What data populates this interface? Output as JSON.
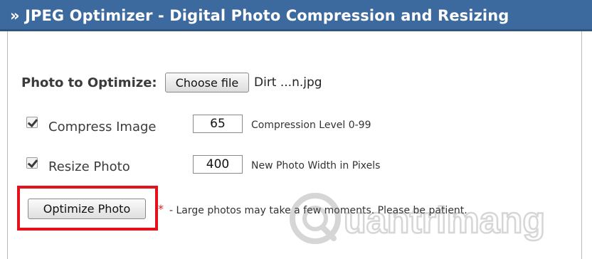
{
  "header": {
    "title": "» JPEG Optimizer - Digital Photo Compression and Resizing"
  },
  "file": {
    "label": "Photo to Optimize:",
    "button_label": "Choose file",
    "file_name": "Dirt ...n.jpg"
  },
  "options": [
    {
      "label": "Compress Image",
      "checked": true,
      "value": "65",
      "hint": "Compression Level 0-99"
    },
    {
      "label": "Resize Photo",
      "checked": true,
      "value": "400",
      "hint": "New Photo Width in Pixels"
    }
  ],
  "submit": {
    "label": "Optimize Photo",
    "asterisk": "*",
    "note": " - Large photos may take a few moments. Please be patient."
  },
  "watermark": {
    "text": "uantrimang"
  },
  "colors": {
    "header_bg": "#3d6a9e",
    "highlight": "#e4101a",
    "asterisk": "#e0202a"
  }
}
